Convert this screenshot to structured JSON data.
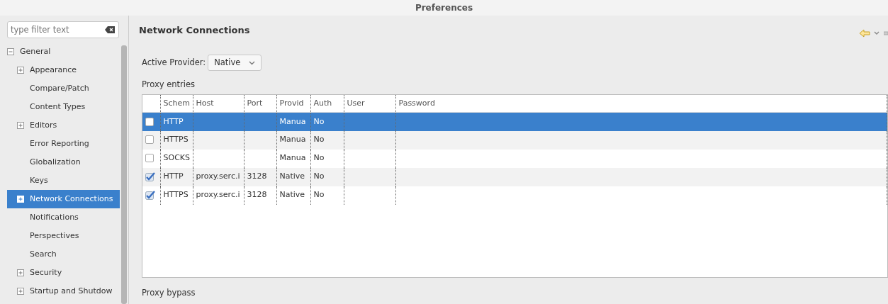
{
  "window": {
    "title": "Preferences"
  },
  "filter": {
    "placeholder": "type filter text"
  },
  "tree": [
    {
      "label": "General",
      "expanded": true,
      "selected": false,
      "children": [
        {
          "label": "Appearance",
          "expanded": false,
          "selected": false
        },
        {
          "label": "Compare/Patch",
          "selected": false
        },
        {
          "label": "Content Types",
          "selected": false
        },
        {
          "label": "Editors",
          "expanded": false,
          "selected": false
        },
        {
          "label": "Error Reporting",
          "selected": false
        },
        {
          "label": "Globalization",
          "selected": false
        },
        {
          "label": "Keys",
          "selected": false
        },
        {
          "label": "Network Connections",
          "expanded": false,
          "selected": true
        },
        {
          "label": "Notifications",
          "selected": false
        },
        {
          "label": "Perspectives",
          "selected": false
        },
        {
          "label": "Search",
          "selected": false
        },
        {
          "label": "Security",
          "expanded": false,
          "selected": false
        },
        {
          "label": "Startup and Shutdow",
          "expanded": false,
          "selected": false
        }
      ]
    }
  ],
  "page": {
    "title": "Network Connections",
    "provider_label": "Active Provider:",
    "provider": "Native",
    "entries_label": "Proxy entries",
    "bypass_label": "Proxy bypass"
  },
  "table": {
    "columns": [
      "Schem",
      "Host",
      "Port",
      "Provid",
      "Auth",
      "User",
      "Password"
    ],
    "rows": [
      {
        "checked": false,
        "selected": true,
        "cells": [
          "HTTP",
          "",
          "",
          "Manua",
          "No",
          "",
          ""
        ]
      },
      {
        "checked": false,
        "selected": false,
        "cells": [
          "HTTPS",
          "",
          "",
          "Manua",
          "No",
          "",
          ""
        ]
      },
      {
        "checked": false,
        "selected": false,
        "cells": [
          "SOCKS",
          "",
          "",
          "Manua",
          "No",
          "",
          ""
        ]
      },
      {
        "checked": true,
        "selected": false,
        "cells": [
          "HTTP",
          "proxy.serc.i",
          "3128",
          "Native",
          "No",
          "",
          ""
        ]
      },
      {
        "checked": true,
        "selected": false,
        "cells": [
          "HTTPS",
          "proxy.serc.i",
          "3128",
          "Native",
          "No",
          "",
          ""
        ]
      }
    ]
  }
}
